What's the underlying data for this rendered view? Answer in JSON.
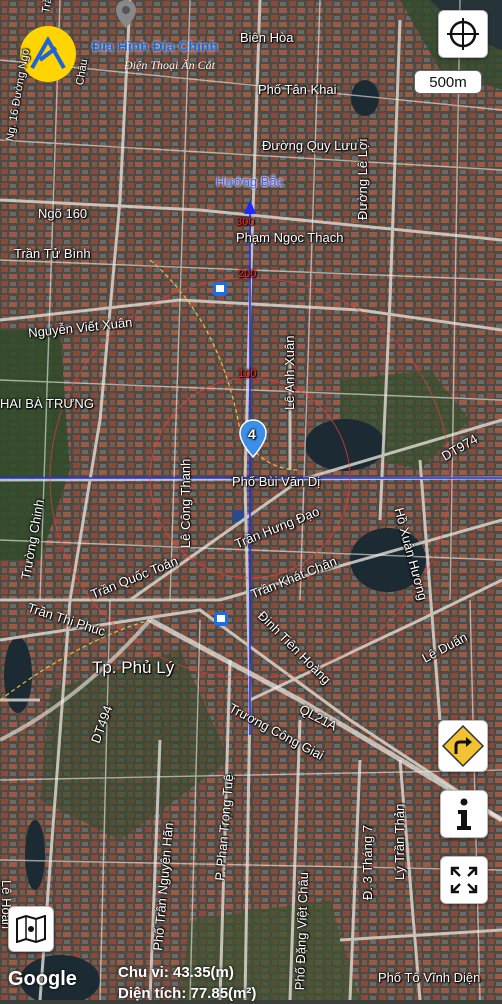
{
  "branding": {
    "name": "Địa Hình Địa Chính",
    "tagline": "Điện Thoại Ăn Cắt"
  },
  "map": {
    "scale_label": "500m",
    "attribution": "Google",
    "direction_label": "Hướng Bắc",
    "current_position_marker": "4",
    "measure_ticks": [
      "300",
      "200",
      "100"
    ],
    "area_label": "Tp. Phủ Lý"
  },
  "streets": {
    "bien_hoa": "Biên Hòa",
    "tan_khai": "Phố Tân Khai",
    "quy_luu": "Đường Quy Lưu",
    "ngo160": "Ngõ 160",
    "tran_tu_binh": "Trần Tử Bình",
    "pham_ngoc_thach": "Phạm Ngọc Thạch",
    "nguyen_viet_xuan": "Nguyễn Viết Xuân",
    "hai_ba_trung": "HAI BÀ TRƯNG",
    "le_loi": "Đường Lê Lợi",
    "le_anh_xuan": "Lê Anh Xuân",
    "dt974": "DT974",
    "bui_van_di": "Phố Bùi Văn Dị",
    "le_cong_thanh": "Lê Công Thanh",
    "tran_hung_dao": "Trần Hưng Đạo",
    "truong_chinh": "Trường Chinh",
    "tran_quoc_toan": "Trần Quốc Toản",
    "tran_khat_chan": "Trần Khát Chân",
    "ho_xuan_huong": "Hồ Xuân Hương",
    "tran_thi_phuc": "Trần Thị Phúc",
    "le_duan": "Lê Duẩn",
    "dinh_tien_hoang": "Đinh Tiên Hoàng",
    "ql21a": "QL21A",
    "truong_cong_giai": "Trương Công Giai",
    "dt494": "DT494",
    "phan_trong_tue": "P. Phan Trọng Tuệ",
    "tran_nguyen_han": "Phố Trần Nguyên Hãn",
    "dang_viet_chau": "Phố Đặng Việt Châu",
    "thang7": "Đ. 3 Tháng 7",
    "ly_tran_than": "Lý Trần Thản",
    "to_vinh_dien": "Phố Tô Vĩnh Diện",
    "le_hoan": "Lê Hoàn",
    "ng16": "Ng. 16 Đường Ngô",
    "chau": "Châu",
    "tran": "Trần"
  },
  "footer": {
    "perimeter": "Chu vi: 43.35(m)",
    "area": "Diện tích: 77.85(m²)"
  },
  "icons": {
    "locate": "crosshair-icon",
    "directions": "turn-right-sign-icon",
    "info": "info-icon",
    "fullscreen": "expand-icon",
    "layers": "map-layers-icon"
  }
}
